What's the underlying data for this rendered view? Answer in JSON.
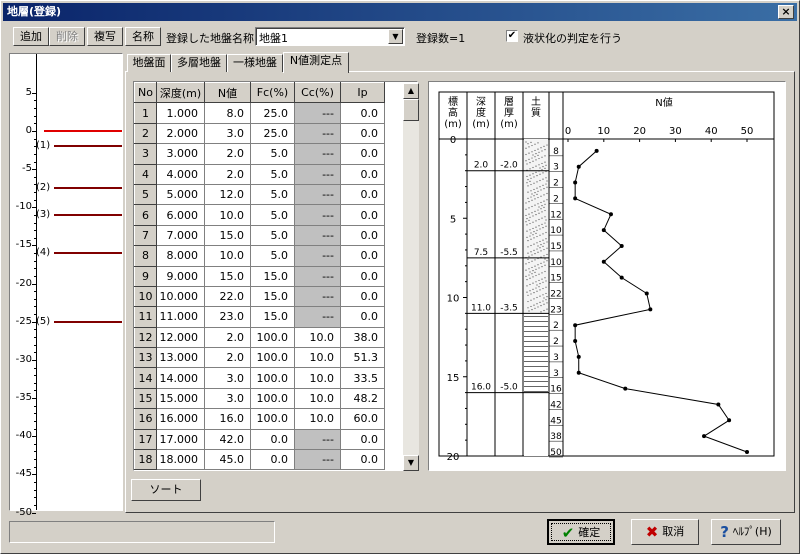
{
  "window": {
    "title": "地層(登録)",
    "close_glyph": "×"
  },
  "toolbar": {
    "add": "追加",
    "delete": "削除",
    "copy": "複写",
    "rename": "名称",
    "registered_label": "登録した地盤名称",
    "ground_name": "地盤1",
    "count_label": "登録数=1",
    "liquefaction_label": "液状化の判定を行う",
    "liquefaction_checked": "✔"
  },
  "left_axis": {
    "ticks": [
      "5",
      "0",
      "-5",
      "-10",
      "-15",
      "-20",
      "-25",
      "-30",
      "-35",
      "-40",
      "-45",
      "-50"
    ],
    "layers": [
      "(1)",
      "(2)",
      "(3)",
      "(4)",
      "(5)"
    ]
  },
  "tabs": [
    "地盤面",
    "多層地盤",
    "一様地盤",
    "N値測定点"
  ],
  "table": {
    "headers": [
      "No",
      "深度(m)",
      "N値",
      "Fc(%)",
      "Cc(%)",
      "Ip"
    ],
    "rows": [
      [
        "1",
        "1.000",
        "8.0",
        "25.0",
        "---",
        "0.0"
      ],
      [
        "2",
        "2.000",
        "3.0",
        "25.0",
        "---",
        "0.0"
      ],
      [
        "3",
        "3.000",
        "2.0",
        "5.0",
        "---",
        "0.0"
      ],
      [
        "4",
        "4.000",
        "2.0",
        "5.0",
        "---",
        "0.0"
      ],
      [
        "5",
        "5.000",
        "12.0",
        "5.0",
        "---",
        "0.0"
      ],
      [
        "6",
        "6.000",
        "10.0",
        "5.0",
        "---",
        "0.0"
      ],
      [
        "7",
        "7.000",
        "15.0",
        "5.0",
        "---",
        "0.0"
      ],
      [
        "8",
        "8.000",
        "10.0",
        "5.0",
        "---",
        "0.0"
      ],
      [
        "9",
        "9.000",
        "15.0",
        "15.0",
        "---",
        "0.0"
      ],
      [
        "10",
        "10.000",
        "22.0",
        "15.0",
        "---",
        "0.0"
      ],
      [
        "11",
        "11.000",
        "23.0",
        "15.0",
        "---",
        "0.0"
      ],
      [
        "12",
        "12.000",
        "2.0",
        "100.0",
        "10.0",
        "38.0"
      ],
      [
        "13",
        "13.000",
        "2.0",
        "100.0",
        "10.0",
        "51.3"
      ],
      [
        "14",
        "14.000",
        "3.0",
        "100.0",
        "10.0",
        "33.5"
      ],
      [
        "15",
        "15.000",
        "3.0",
        "100.0",
        "10.0",
        "48.2"
      ],
      [
        "16",
        "16.000",
        "16.0",
        "100.0",
        "10.0",
        "60.0"
      ],
      [
        "17",
        "17.000",
        "42.0",
        "0.0",
        "---",
        "0.0"
      ],
      [
        "18",
        "18.000",
        "45.0",
        "0.0",
        "---",
        "0.0"
      ]
    ]
  },
  "sort_button": "ソート",
  "chart_data": {
    "type": "line",
    "col_headers": {
      "elev": "標\n高\n(m)",
      "depth": "深\n度\n(m)",
      "thick": "層\n厚\n(m)",
      "soil": "土\n質",
      "nval": "N値"
    },
    "x_ticks": [
      "0",
      "10",
      "20",
      "30",
      "40",
      "50"
    ],
    "y_ticks": [
      "0",
      "5",
      "10",
      "15",
      "20"
    ],
    "boundaries": [
      {
        "depth": "2.0",
        "thick": "-2.0",
        "y": 2
      },
      {
        "depth": "7.5",
        "thick": "-5.5",
        "y": 7.5
      },
      {
        "depth": "11.0",
        "thick": "-3.5",
        "y": 11
      },
      {
        "depth": "16.0",
        "thick": "-5.0",
        "y": 16
      }
    ],
    "depths": [
      1,
      2,
      3,
      4,
      5,
      6,
      7,
      8,
      9,
      10,
      11,
      12,
      13,
      14,
      15,
      16,
      17,
      18,
      19,
      20
    ],
    "n_values": [
      8,
      3,
      2,
      2,
      12,
      10,
      15,
      10,
      15,
      22,
      23,
      2,
      2,
      3,
      3,
      16,
      42,
      45,
      38,
      50
    ],
    "n_labels": [
      "8",
      "3",
      "2",
      "2",
      "12",
      "10",
      "15",
      "10",
      "15",
      "22",
      "23",
      "2",
      "2",
      "3",
      "3",
      "16",
      "42",
      "45",
      "38",
      "50"
    ],
    "xlim": [
      0,
      50
    ],
    "ylim": [
      0,
      20
    ]
  },
  "buttons": {
    "ok": "確定",
    "cancel": "取消",
    "help": "ﾍﾙﾌﾟ(H)",
    "ok_icon": "✔",
    "cancel_icon": "✖",
    "help_icon": "?"
  }
}
